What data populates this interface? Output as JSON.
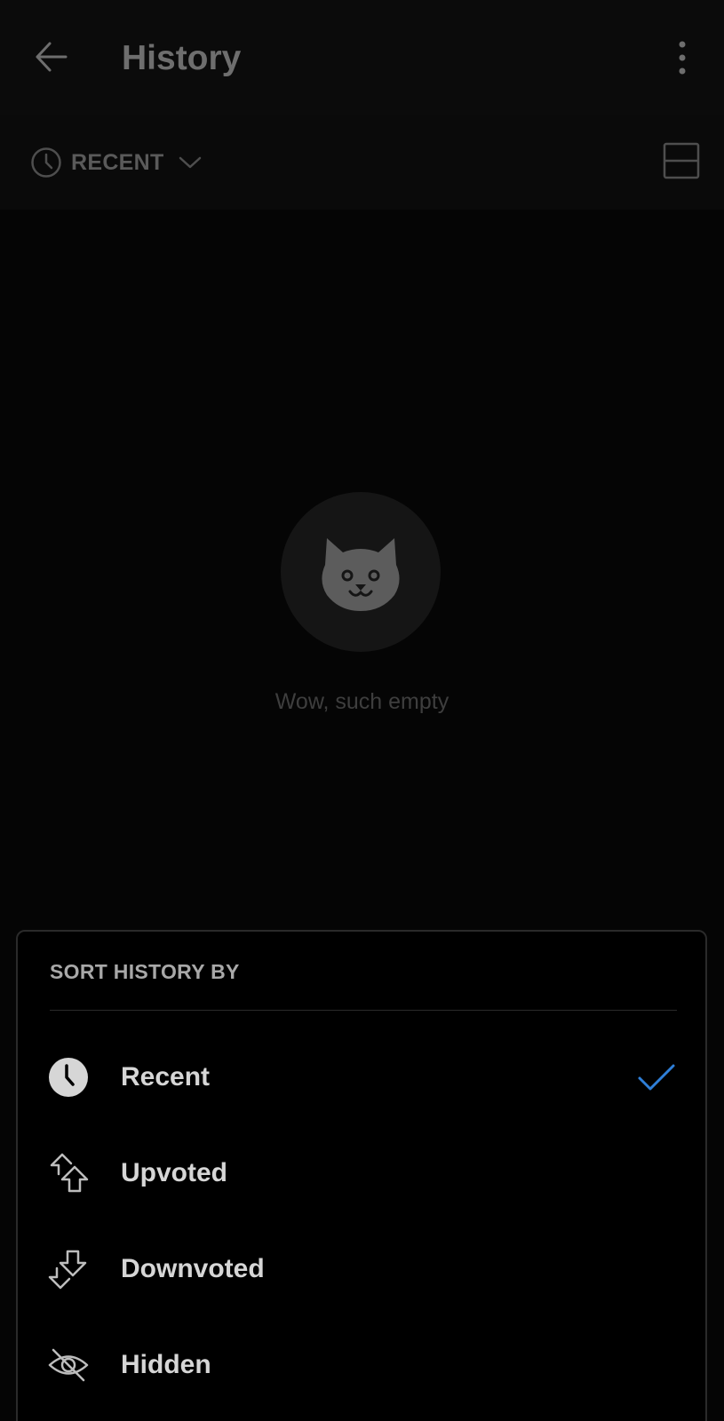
{
  "header": {
    "title": "History",
    "back_icon": "back-arrow-icon",
    "more_icon": "more-vertical-icon"
  },
  "sort_bar": {
    "label": "RECENT",
    "clock_icon": "clock-icon",
    "chevron_icon": "chevron-down-icon",
    "layout_icon": "card-layout-icon"
  },
  "empty_state": {
    "icon": "cat-icon",
    "message": "Wow, such empty"
  },
  "sort_sheet": {
    "title": "SORT HISTORY BY",
    "options": [
      {
        "label": "Recent",
        "icon": "clock-icon",
        "selected": true
      },
      {
        "label": "Upvoted",
        "icon": "upvote-icon",
        "selected": false
      },
      {
        "label": "Downvoted",
        "icon": "downvote-icon",
        "selected": false
      },
      {
        "label": "Hidden",
        "icon": "hidden-eye-icon",
        "selected": false
      }
    ]
  },
  "colors": {
    "background": "#000000",
    "accent_check": "#2f7fd8",
    "sheet_text": "#d6d6d6",
    "dimmed_text": "#6e6e6e"
  }
}
